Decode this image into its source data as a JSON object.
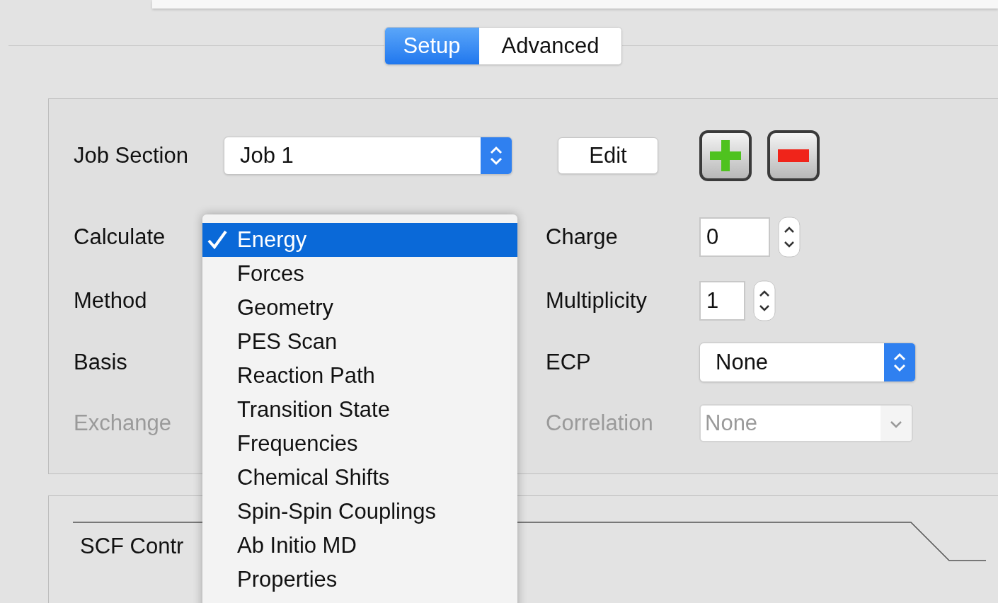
{
  "tabs": [
    {
      "label": "Setup",
      "selected": true
    },
    {
      "label": "Advanced",
      "selected": false
    }
  ],
  "job_section": {
    "label": "Job Section",
    "value": "Job 1",
    "edit_button": "Edit"
  },
  "left_fields": [
    {
      "label": "Calculate",
      "disabled": false
    },
    {
      "label": "Method",
      "disabled": false
    },
    {
      "label": "Basis",
      "disabled": false
    },
    {
      "label": "Exchange",
      "disabled": true
    }
  ],
  "right_fields": [
    {
      "label": "Charge",
      "kind": "spinbox",
      "value": "0",
      "disabled": false
    },
    {
      "label": "Multiplicity",
      "kind": "spinbox",
      "value": "1",
      "disabled": false
    },
    {
      "label": "ECP",
      "kind": "combo",
      "value": "None",
      "disabled": false
    },
    {
      "label": "Correlation",
      "kind": "combo",
      "value": "None",
      "disabled": true
    }
  ],
  "scf_section": {
    "label": "SCF Contr"
  },
  "menu": {
    "items": [
      {
        "label": "Energy",
        "selected": true
      },
      {
        "label": "Forces",
        "selected": false
      },
      {
        "label": "Geometry",
        "selected": false
      },
      {
        "label": "PES Scan",
        "selected": false
      },
      {
        "label": "Reaction Path",
        "selected": false
      },
      {
        "label": "Transition State",
        "selected": false
      },
      {
        "label": "Frequencies",
        "selected": false
      },
      {
        "label": "Chemical Shifts",
        "selected": false
      },
      {
        "label": "Spin-Spin Couplings",
        "selected": false
      },
      {
        "label": "Ab Initio MD",
        "selected": false
      },
      {
        "label": "Properties",
        "selected": false
      }
    ]
  }
}
